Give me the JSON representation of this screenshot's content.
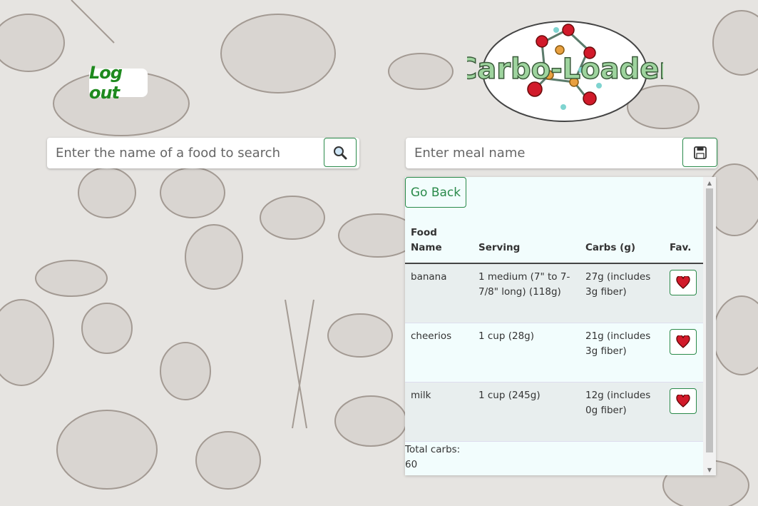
{
  "header": {
    "logout_label": "Log out",
    "logo_text": "Carbo-Loader"
  },
  "search": {
    "placeholder": "Enter the name of a food to search",
    "value": ""
  },
  "meal": {
    "placeholder": "Enter meal name",
    "value": ""
  },
  "panel": {
    "go_back_label": "Go Back",
    "columns": [
      "Food Name",
      "Serving",
      "Carbs (g)",
      "Fav."
    ],
    "rows": [
      {
        "food": "banana",
        "serving": "1 medium (7\" to 7-7/8\" long) (118g)",
        "carbs": "27g (includes 3g fiber)"
      },
      {
        "food": "cheerios",
        "serving": "1 cup (28g)",
        "carbs": "21g (includes 3g fiber)"
      },
      {
        "food": "milk",
        "serving": "1 cup (245g)",
        "carbs": "12g (includes 0g fiber)"
      }
    ],
    "total_label": "Total carbs:",
    "total_value": "60"
  },
  "colors": {
    "accent_green": "#2a8a4a",
    "logout_green": "#1e8a1e",
    "panel_bg": "#f2fdfd",
    "heart_red": "#d11a2a"
  },
  "icons": {
    "search": "magnifier-icon",
    "save": "floppy-disk-icon",
    "favorite": "heart-icon"
  }
}
